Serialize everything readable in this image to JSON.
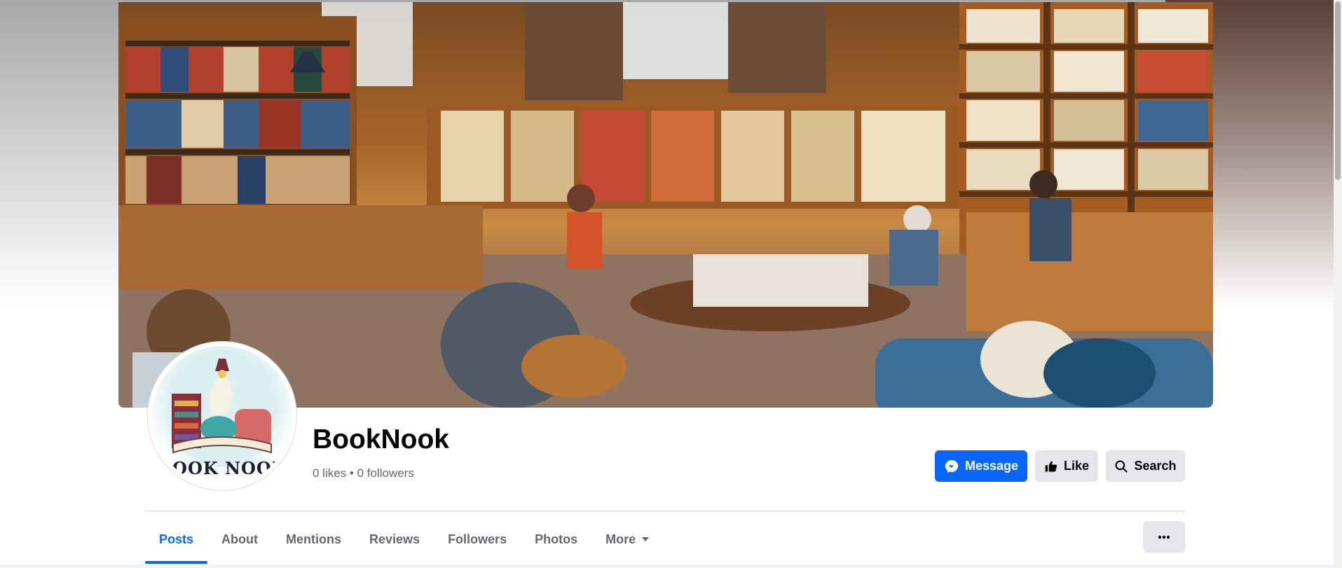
{
  "page": {
    "name": "BookNook",
    "stats": "0 likes • 0 followers",
    "avatar_text": "BOOK NOOK"
  },
  "actions": {
    "message_label": "Message",
    "like_label": "Like",
    "search_label": "Search"
  },
  "tabs": [
    {
      "label": "Posts",
      "active": true
    },
    {
      "label": "About"
    },
    {
      "label": "Mentions"
    },
    {
      "label": "Reviews"
    },
    {
      "label": "Followers"
    },
    {
      "label": "Photos"
    },
    {
      "label": "More"
    }
  ],
  "icons": {
    "message": "messenger-icon",
    "like": "thumbs-up-icon",
    "search": "search-icon",
    "more": "chevron-down-icon",
    "overflow": "ellipsis-icon"
  },
  "colors": {
    "accent": "#0866ff",
    "button_secondary": "#e4e6eb",
    "text_primary": "#050505",
    "text_secondary": "#65676b"
  }
}
